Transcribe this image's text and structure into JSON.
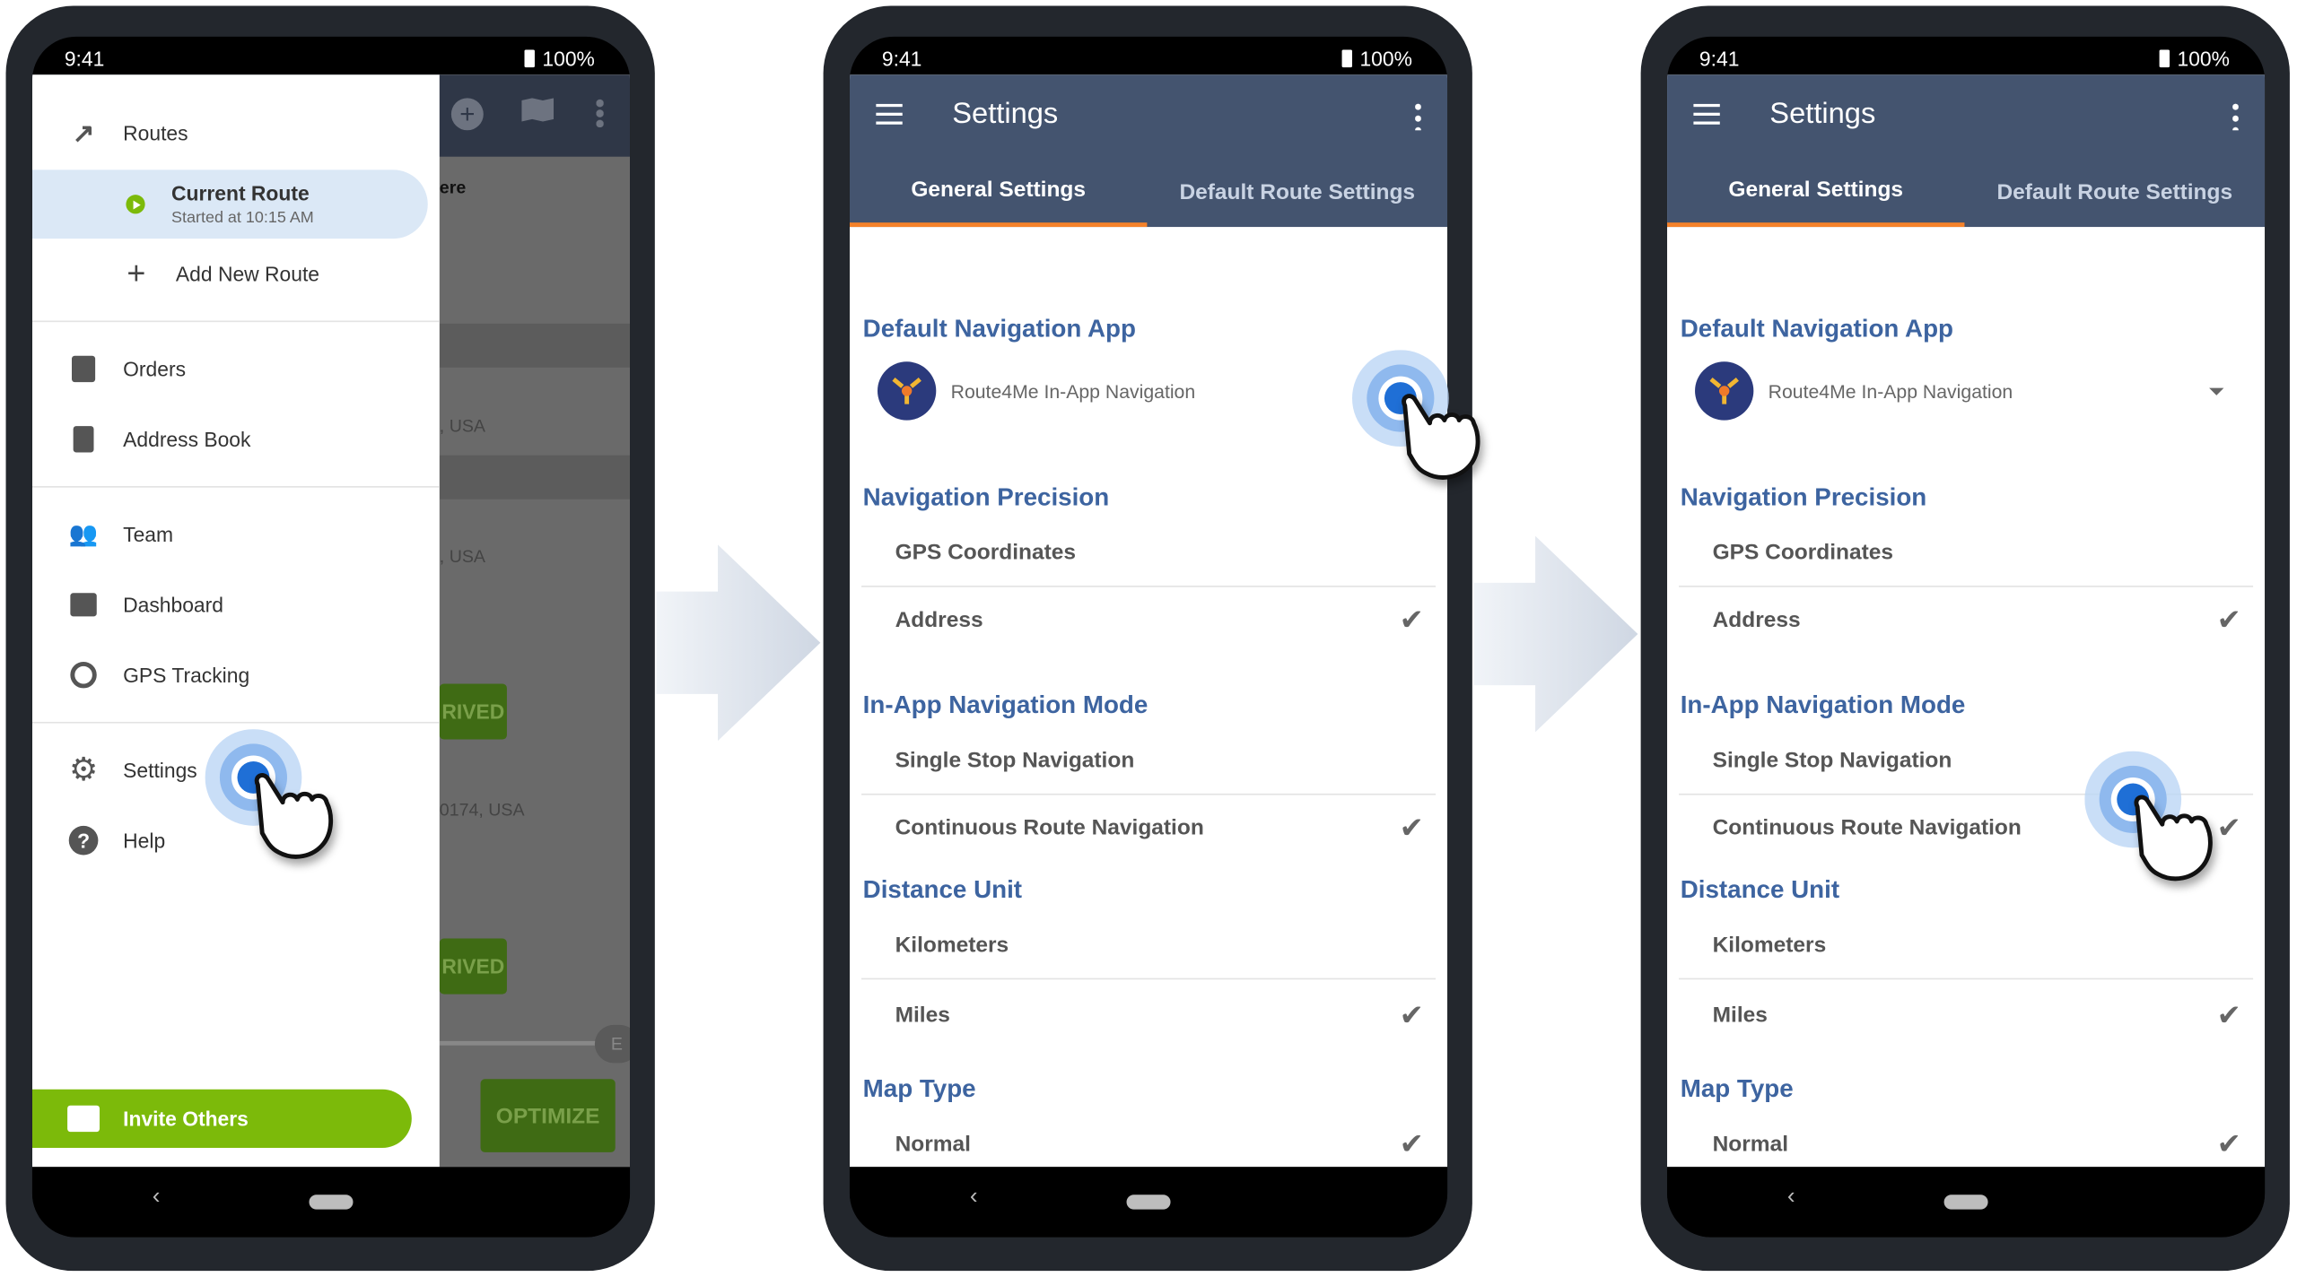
{
  "status": {
    "time": "9:41",
    "battery": "100%"
  },
  "drawer": {
    "routes": "Routes",
    "current_route": "Current Route",
    "current_route_sub": "Started at 10:15 AM",
    "add_route": "Add New Route",
    "orders": "Orders",
    "address_book": "Address Book",
    "team": "Team",
    "dashboard": "Dashboard",
    "gps_tracking": "GPS Tracking",
    "settings": "Settings",
    "help": "Help",
    "invite": "Invite Others"
  },
  "background_screen": {
    "text1": "ere",
    "usa1": ", USA",
    "usa2": ", USA",
    "arrived1": "RIVED",
    "zip": "0174, USA",
    "arrived2": "RIVED",
    "e": "E",
    "optimize": "OPTIMIZE"
  },
  "settings": {
    "title": "Settings",
    "tabs": [
      "General Settings",
      "Default Route Settings"
    ],
    "nav_app_title": "Default Navigation App",
    "nav_app_value": "Route4Me In-App Navigation",
    "precision_title": "Navigation Precision",
    "precision_options": [
      "GPS Coordinates",
      "Address"
    ],
    "mode_title": "In-App Navigation Mode",
    "mode_options": [
      "Single Stop Navigation",
      "Continuous Route Navigation"
    ],
    "distance_title": "Distance Unit",
    "distance_options": [
      "Kilometers",
      "Miles"
    ],
    "map_title": "Map Type",
    "map_options": [
      "Normal"
    ]
  },
  "colors": {
    "header": "#44546f",
    "accent_tab": "#f5822a",
    "section": "#3d64a0",
    "invite": "#7cba0a",
    "tap": "#1f6fd6"
  }
}
